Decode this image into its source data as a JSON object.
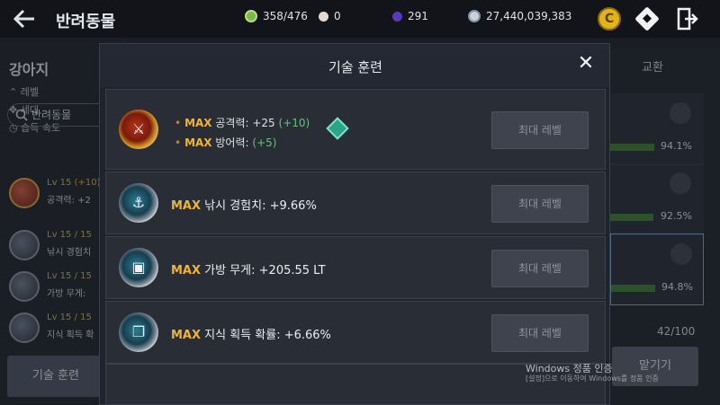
{
  "topbar": {
    "title": "반려동물",
    "resources": [
      {
        "icon": "fish-token-icon",
        "value": "358/476",
        "color": "#9ccf6a"
      },
      {
        "icon": "pearl-icon",
        "value": "0",
        "color": "#d6c3b8"
      },
      {
        "icon": "gem-purple-icon",
        "value": "291",
        "color": "#6a4cc9"
      },
      {
        "icon": "silver-coin-icon",
        "value": "27,440,039,383",
        "color": "#b9c6d6"
      }
    ],
    "coin_button_glyph": "C"
  },
  "left_panel": {
    "title": "강아지",
    "stats": [
      "레벨",
      "세대",
      "습득 속도"
    ],
    "search_label": "반려동물",
    "rows": [
      {
        "level": "Lv 15 (+10)",
        "text": "공격력: +2"
      },
      {
        "level": "Lv 15 / 15",
        "text": "낚시 경험치"
      },
      {
        "level": "Lv 15 / 15",
        "text": "가방 무게:"
      },
      {
        "level": "Lv 15 / 15",
        "text": "지식 획득 확"
      }
    ],
    "train_button": "기술 훈련"
  },
  "right_panel": {
    "tab_label": "교환",
    "cards": [
      {
        "pct": "94.1%",
        "fill": 0.941
      },
      {
        "pct": "92.5%",
        "fill": 0.925
      },
      {
        "pct": "94.8%",
        "fill": 0.948
      }
    ],
    "count": "42/100",
    "action_button": "맡기기"
  },
  "modal": {
    "title": "기술 훈련",
    "max_label": "MAX",
    "max_button_label": "최대 레벨",
    "skills": [
      {
        "medal": "gold",
        "icon": "sword-medal-icon",
        "lines": [
          {
            "text": "공격력: +25",
            "bonus": "(+10)"
          },
          {
            "text": "방어력:",
            "bonus": "(+5)"
          }
        ]
      },
      {
        "medal": "silver",
        "icon": "fishing-rod-medal-icon",
        "text": "낚시 경험치: +9.66%"
      },
      {
        "medal": "silver",
        "icon": "bag-medal-icon",
        "text": "가방 무게: +205.55 LT"
      },
      {
        "medal": "silver",
        "icon": "book-medal-icon",
        "text": "지식 획득 확률: +6.66%"
      }
    ]
  },
  "watermark": {
    "line1": "Windows 정품 인증",
    "line2": "[설정]으로 이동하여 Windows를 정품 인증"
  }
}
